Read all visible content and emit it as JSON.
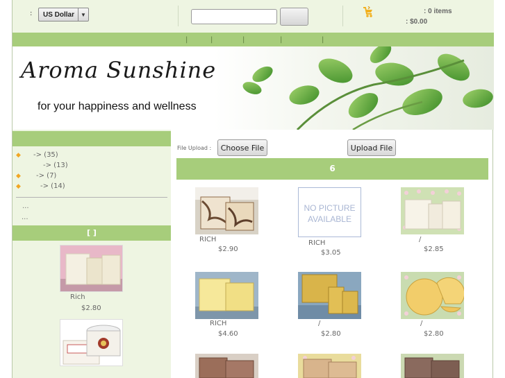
{
  "header": {
    "currency_prefix": ":",
    "currency_selected": "US Dollar",
    "cart_items": ": 0 items",
    "cart_total": ": $0.00"
  },
  "nav": {
    "separator": "|"
  },
  "banner": {
    "title": "Aroma Sunshine",
    "tagline": "for your happiness and wellness"
  },
  "sidebar": {
    "categories": [
      {
        "label": "-> (35)"
      },
      {
        "label": "-> (13)"
      },
      {
        "label": "-> (7)"
      },
      {
        "label": "-> (14)"
      }
    ],
    "more_1": "...",
    "more_2": "...",
    "featured_header": "[ ]",
    "featured": [
      {
        "name": "Rich",
        "price": "$2.80"
      }
    ]
  },
  "upload": {
    "label": "File Upload :",
    "choose_label": "Choose File",
    "upload_label": "Upload File"
  },
  "listing": {
    "header": "6",
    "nopicture_text": "NO PICTURE AVAILABLE",
    "products": [
      {
        "name": "RICH",
        "price": "$2.90"
      },
      {
        "name": "RICH",
        "price": "$3.05"
      },
      {
        "name": "/",
        "price": "$2.85"
      },
      {
        "name": "RICH",
        "price": "$4.60"
      },
      {
        "name": "/",
        "price": "$2.80"
      },
      {
        "name": "/",
        "price": "$2.80"
      }
    ]
  },
  "colors": {
    "nav_green": "#a7cd7b",
    "panel_tint": "#eef5e2",
    "cart_icon": "#f2b01e"
  }
}
